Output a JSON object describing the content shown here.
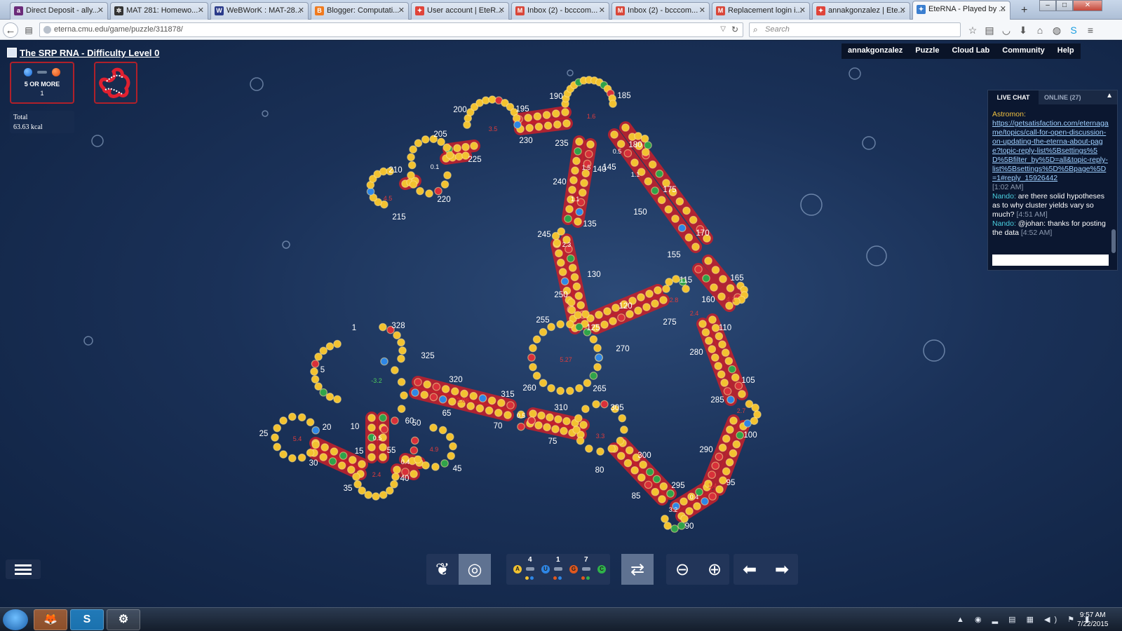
{
  "browser": {
    "tabs": [
      {
        "title": "Direct Deposit - ally...",
        "icon_color": "#6b2b7a",
        "icon_letter": "a"
      },
      {
        "title": "MAT 281: Homewo...",
        "icon_color": "#333333",
        "icon_letter": "✲"
      },
      {
        "title": "WeBWorK : MAT-28...",
        "icon_color": "#2a3a8a",
        "icon_letter": "W"
      },
      {
        "title": "Blogger: Computati...",
        "icon_color": "#f07a1e",
        "icon_letter": "B"
      },
      {
        "title": "User account | EteR...",
        "icon_color": "#e0443a",
        "icon_letter": "✦"
      },
      {
        "title": "Inbox (2) - bcccom...",
        "icon_color": "#d9473a",
        "icon_letter": "M"
      },
      {
        "title": "Inbox (2) - bcccom...",
        "icon_color": "#d9473a",
        "icon_letter": "M"
      },
      {
        "title": "Replacement login i...",
        "icon_color": "#d9473a",
        "icon_letter": "M"
      },
      {
        "title": "annakgonzalez | Ete...",
        "icon_color": "#e0443a",
        "icon_letter": "✦"
      },
      {
        "title": "EteRNA - Played by ...",
        "icon_color": "#3b7fd0",
        "icon_letter": "✦"
      }
    ],
    "new_tab": "+",
    "window_controls": [
      "–",
      "□",
      "✕"
    ],
    "url": "eterna.cmu.edu/game/puzzle/311878/",
    "search_placeholder": "Search"
  },
  "game": {
    "title": "The SRP RNA - Difficulty Level 0",
    "constraint": {
      "label": "5 OR MORE",
      "value": "1"
    },
    "energy": {
      "label": "Total",
      "value": "63.63 kcal"
    },
    "nav": [
      "annakgonzalez",
      "Puzzle",
      "Cloud Lab",
      "Community",
      "Help"
    ],
    "chat": {
      "tabs": {
        "live": "LIVE CHAT",
        "online": "ONLINE (27)"
      },
      "collapse_icon": "▲",
      "messages": [
        {
          "user": "Astromon",
          "link": "https://getsatisfaction.com/eternagame/topics/call-for-open-discussion-on-updating-the-eterna-about-page?topic-reply-list%5Bsettings%5D%5Bfilter_by%5D=all&topic-reply-list%5Bsettings%5D%5Bpage%5D=1#reply_15926442",
          "time": "[1:02 AM]"
        },
        {
          "user": "Nando",
          "text": "are there solid hypotheses as to why cluster yields vary so much?",
          "time": "[4:51 AM]"
        },
        {
          "user": "Nando",
          "text": "@johan: thanks for posting the data",
          "time": "[4:52 AM]"
        }
      ]
    },
    "palette": {
      "bases": [
        {
          "letter": "A",
          "color": "#f2c230"
        },
        {
          "letter": "U",
          "color": "#2e86e6"
        },
        {
          "letter": "G",
          "color": "#e0581e"
        },
        {
          "letter": "C",
          "color": "#2fb34a"
        }
      ],
      "pair_counts": {
        "au": "4",
        "gu": "1",
        "gc": "7"
      }
    },
    "rna": {
      "index_labels": [
        "1",
        "5",
        "10",
        "15",
        "20",
        "25",
        "30",
        "35",
        "40",
        "45",
        "50",
        "55",
        "60",
        "65",
        "70",
        "75",
        "80",
        "85",
        "90",
        "95",
        "100",
        "105",
        "110",
        "115",
        "120",
        "125",
        "130",
        "135",
        "140",
        "145",
        "150",
        "155",
        "160",
        "165",
        "170",
        "175",
        "180",
        "185",
        "190",
        "195",
        "200",
        "205",
        "210",
        "215",
        "220",
        "225",
        "230",
        "235",
        "240",
        "245",
        "250",
        "255",
        "260",
        "265",
        "270",
        "275",
        "280",
        "285",
        "290",
        "295",
        "300",
        "305",
        "310",
        "315",
        "320",
        "325",
        "328"
      ],
      "energy_labels": [
        "-3.2",
        "5.4",
        "4.9",
        "2.4",
        "0.5",
        "0.4",
        "0.5",
        "3.3",
        "5.27",
        "3.2",
        "0.4",
        "1.4",
        "2.7",
        "1.6",
        "3.5",
        "0.1",
        "4.5",
        "2.4",
        "2.8",
        "4.1",
        "1.1",
        "2.3",
        "1.1",
        "1.5",
        "0.5",
        "2.86"
      ],
      "colors": {
        "A": "#f2c230",
        "U": "#2e86e6",
        "G": "#d8303a",
        "C": "#2fa34a",
        "pair_highlight": "#c8202a"
      }
    }
  },
  "taskbar": {
    "apps": [
      {
        "name": "firefox",
        "glyph": "🦊"
      },
      {
        "name": "skype",
        "glyph": "S"
      },
      {
        "name": "steam",
        "glyph": "⚙"
      }
    ],
    "tray": "▲ ◉ ▂ ▤ ▦ ◀) ⚑ ▮",
    "time": "9:57 AM",
    "date": "7/22/2015"
  }
}
